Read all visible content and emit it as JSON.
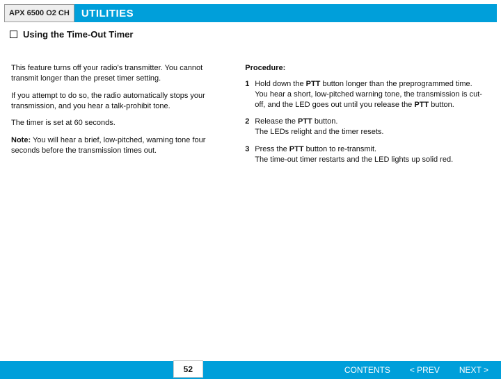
{
  "header": {
    "model": "APX 6500 O2 CH",
    "title": "UTILITIES"
  },
  "subtitle": "Using the Time-Out Timer",
  "left": {
    "p1": "This feature turns off your radio's transmitter. You cannot transmit longer than the preset timer setting.",
    "p2": "If you attempt to do so, the radio automatically stops your transmission, and you hear a talk-prohibit tone.",
    "p3": "The timer is set at 60 seconds.",
    "note_label": "Note:",
    "note_body": " You will hear a brief, low-pitched, warning tone four seconds before the transmission times out."
  },
  "right": {
    "procedure_label": "Procedure:",
    "steps": {
      "s1": {
        "num": "1",
        "a": "Hold down the ",
        "b": "PTT",
        "c": " button longer than the preprogrammed time.",
        "d": "You hear a short, low-pitched warning tone, the transmission is cut-off, and the LED goes out until you release the ",
        "e": "PTT",
        "f": " button."
      },
      "s2": {
        "num": "2",
        "a": "Release the ",
        "b": "PTT",
        "c": " button.",
        "d": "The LEDs relight and the timer resets."
      },
      "s3": {
        "num": "3",
        "a": "Press the ",
        "b": "PTT",
        "c": " button to re-transmit.",
        "d": "The time-out timer restarts and the LED lights up solid red."
      }
    }
  },
  "footer": {
    "page": "52",
    "contents": "CONTENTS",
    "prev": "< PREV",
    "next": "NEXT >"
  }
}
